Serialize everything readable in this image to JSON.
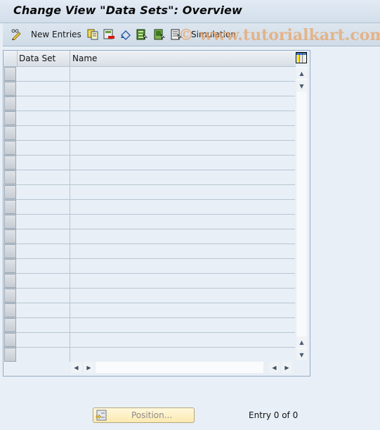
{
  "header": {
    "title": "Change View \"Data Sets\": Overview"
  },
  "toolbar": {
    "items": [
      {
        "icon": "change-display-icon"
      },
      {
        "label": "New Entries"
      },
      {
        "icon": "copy-icon"
      },
      {
        "icon": "delete-icon"
      },
      {
        "icon": "undo-change-icon"
      },
      {
        "icon": "select-all-icon"
      },
      {
        "icon": "select-block-icon"
      },
      {
        "icon": "deselect-all-icon"
      },
      {
        "label": "Simulation"
      }
    ],
    "watermark": "© www.tutorialkart.com"
  },
  "table": {
    "columns": [
      "Data Set",
      "Name"
    ],
    "row_count": 20,
    "rows": []
  },
  "footer": {
    "position_button": "Position...",
    "entry_status": "Entry 0 of 0"
  }
}
